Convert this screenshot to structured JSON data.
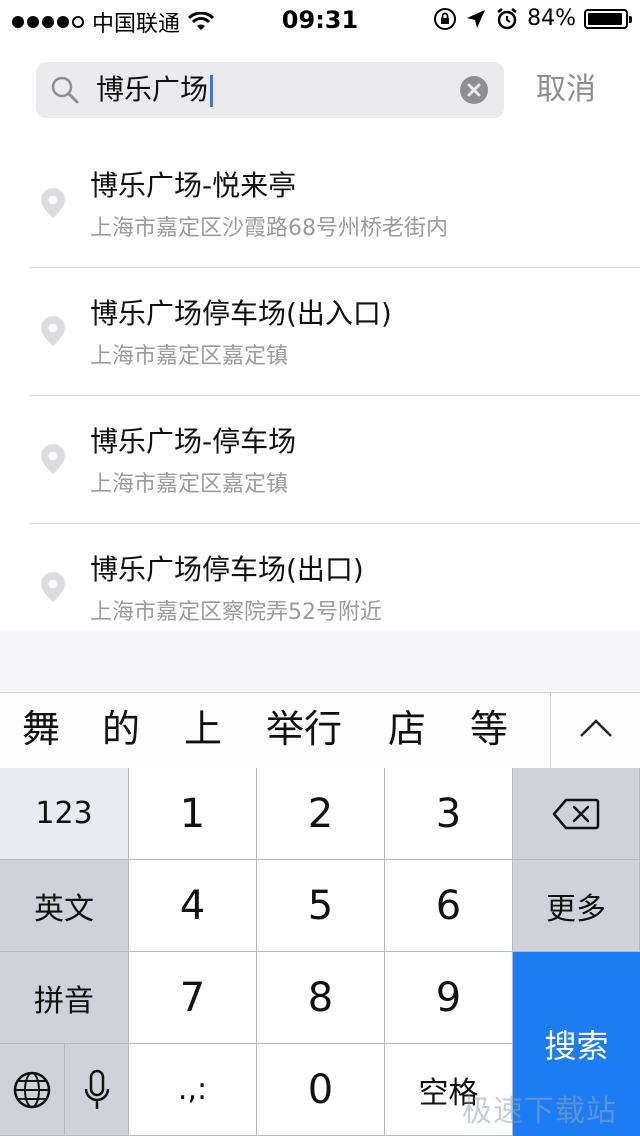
{
  "status_bar": {
    "carrier": "中国联通",
    "time": "09:31",
    "battery": "84%"
  },
  "search": {
    "query": "博乐广场",
    "cancel_label": "取消"
  },
  "results": [
    {
      "title": "博乐广场-悦来亭",
      "address": "上海市嘉定区沙霞路68号州桥老街内"
    },
    {
      "title": "博乐广场停车场(出入口)",
      "address": "上海市嘉定区嘉定镇"
    },
    {
      "title": "博乐广场-停车场",
      "address": "上海市嘉定区嘉定镇"
    },
    {
      "title": "博乐广场停车场(出口)",
      "address": "上海市嘉定区察院弄52号附近"
    }
  ],
  "candidates": [
    "舞",
    "的",
    "上",
    "举行",
    "店",
    "等"
  ],
  "keyboard": {
    "mode_123": "123",
    "mode_english": "英文",
    "mode_pinyin": "拼音",
    "digits": [
      "1",
      "2",
      "3",
      "4",
      "5",
      "6",
      "7",
      "8",
      "9",
      "0"
    ],
    "more": "更多",
    "punct": ".,:",
    "space": "空格",
    "search": "搜索"
  },
  "watermark": "极速下载站",
  "colors": {
    "accent_blue": "#1c7cf4",
    "caret": "#3478f6",
    "secondary_text": "#9a9aa0"
  }
}
